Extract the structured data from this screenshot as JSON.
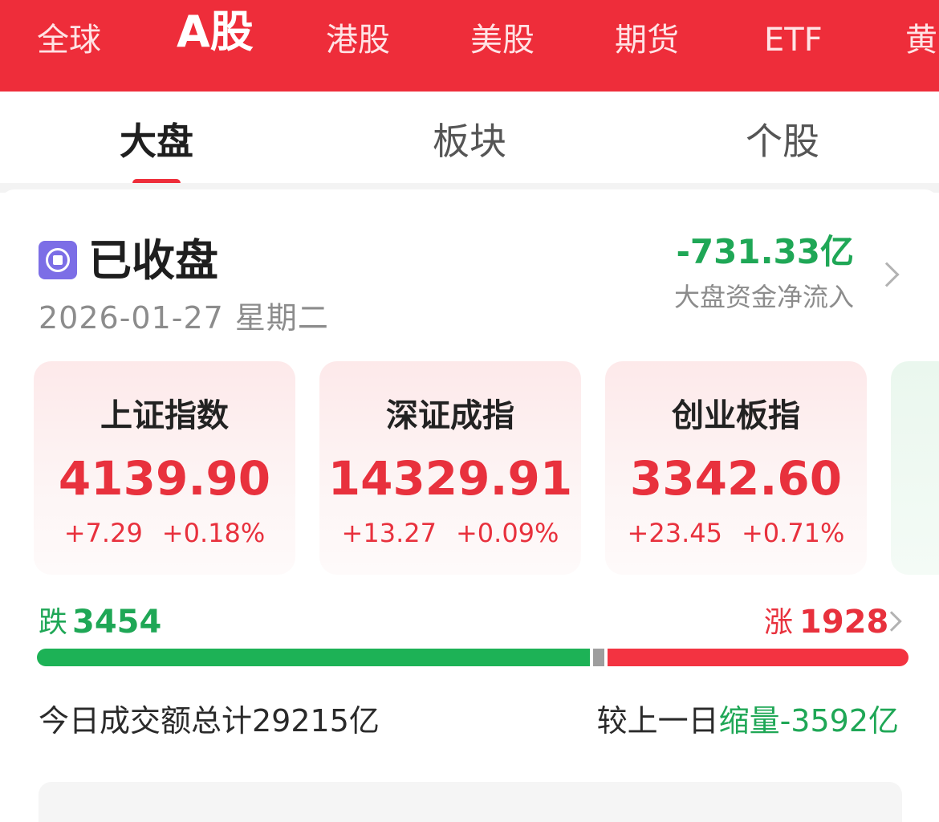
{
  "market_tabs": [
    {
      "label": "全球"
    },
    {
      "label": "A股"
    },
    {
      "label": "港股"
    },
    {
      "label": "美股"
    },
    {
      "label": "期货"
    },
    {
      "label": "ETF"
    },
    {
      "label": "黄"
    }
  ],
  "sub_tabs": [
    {
      "label": "大盘"
    },
    {
      "label": "板块"
    },
    {
      "label": "个股"
    }
  ],
  "status": {
    "icon": "market-closed-icon",
    "text": "已收盘",
    "date": "2026-01-27",
    "weekday": "星期二"
  },
  "fund_flow": {
    "value": "-731.33亿",
    "label": "大盘资金净流入"
  },
  "indices": [
    {
      "name": "上证指数",
      "price": "4139.90",
      "change": "+7.29",
      "change_pct": "+0.18%"
    },
    {
      "name": "深证成指",
      "price": "14329.91",
      "change": "+13.27",
      "change_pct": "+0.09%"
    },
    {
      "name": "创业板指",
      "price": "3342.60",
      "change": "+23.45",
      "change_pct": "+0.71%"
    }
  ],
  "breadth": {
    "down_label": "跌",
    "down_count": "3454",
    "up_label": "涨",
    "up_count": "1928",
    "down": 3454,
    "up": 1928,
    "flat": 60
  },
  "turnover": {
    "text": "今日成交额总计29215亿",
    "compare_prefix": "较上一日",
    "compare_value": "缩量-3592亿"
  },
  "colors": {
    "brand_red": "#ee2d3a",
    "up_red": "#e8313d",
    "down_green": "#1fa756"
  }
}
